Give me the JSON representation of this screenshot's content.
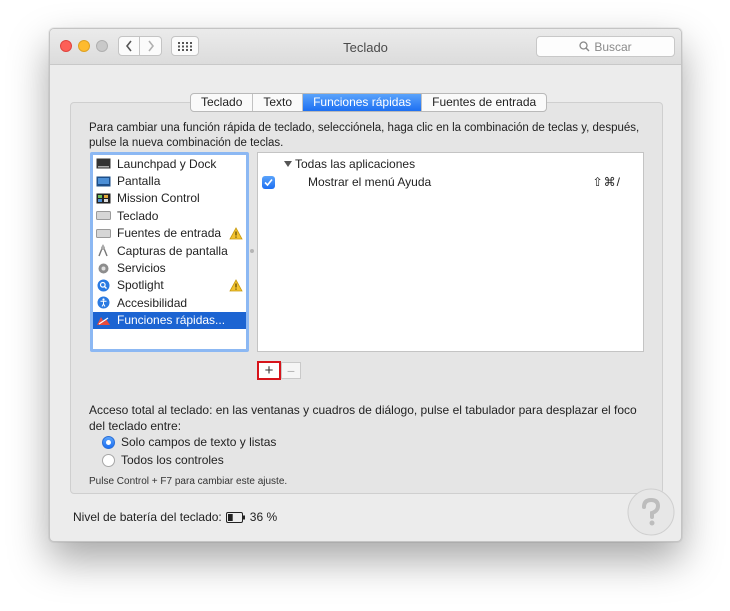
{
  "window": {
    "title": "Teclado"
  },
  "search": {
    "placeholder": "Buscar"
  },
  "tabs": [
    {
      "label": "Teclado",
      "active": false
    },
    {
      "label": "Texto",
      "active": false
    },
    {
      "label": "Funciones rápidas",
      "active": true
    },
    {
      "label": "Fuentes de entrada",
      "active": false
    }
  ],
  "instructions": "Para cambiar una función rápida de teclado, selecciónela, haga clic en la combinación de teclas y, después, pulse la nueva combinación de teclas.",
  "categories": [
    {
      "label": "Launchpad y Dock",
      "icon": "launchpad-icon",
      "warning": false
    },
    {
      "label": "Pantalla",
      "icon": "display-icon",
      "warning": false
    },
    {
      "label": "Mission Control",
      "icon": "mission-control-icon",
      "warning": false
    },
    {
      "label": "Teclado",
      "icon": "keyboard-icon",
      "warning": false
    },
    {
      "label": "Fuentes de entrada",
      "icon": "input-sources-icon",
      "warning": true
    },
    {
      "label": "Capturas de pantalla",
      "icon": "screenshot-icon",
      "warning": false
    },
    {
      "label": "Servicios",
      "icon": "services-gear-icon",
      "warning": false
    },
    {
      "label": "Spotlight",
      "icon": "spotlight-icon",
      "warning": true
    },
    {
      "label": "Accesibilidad",
      "icon": "accessibility-icon",
      "warning": false
    },
    {
      "label": "Funciones rápidas...",
      "icon": "app-shortcuts-icon",
      "warning": false,
      "selected": true
    }
  ],
  "shortcuts": {
    "group": "Todas las aplicaciones",
    "items": [
      {
        "name": "Mostrar el menú Ayuda",
        "keys": "⇧⌘/",
        "checked": true
      }
    ]
  },
  "buttons": {
    "add": "+",
    "remove": "−"
  },
  "access": {
    "text": "Acceso total al teclado: en las ventanas y cuadros de diálogo, pulse el tabulador para desplazar el foco del teclado entre:",
    "options": [
      {
        "label": "Solo campos de texto y listas",
        "selected": true
      },
      {
        "label": "Todos los controles",
        "selected": false
      }
    ],
    "hint": "Pulse Control + F7 para cambiar este ajuste."
  },
  "battery": {
    "label": "Nivel de batería del teclado:",
    "value": "36 %",
    "level": 0.36
  },
  "colors": {
    "accent": "#1d6ff2",
    "selection": "#1c64d2",
    "highlight_border": "#d7141b"
  }
}
